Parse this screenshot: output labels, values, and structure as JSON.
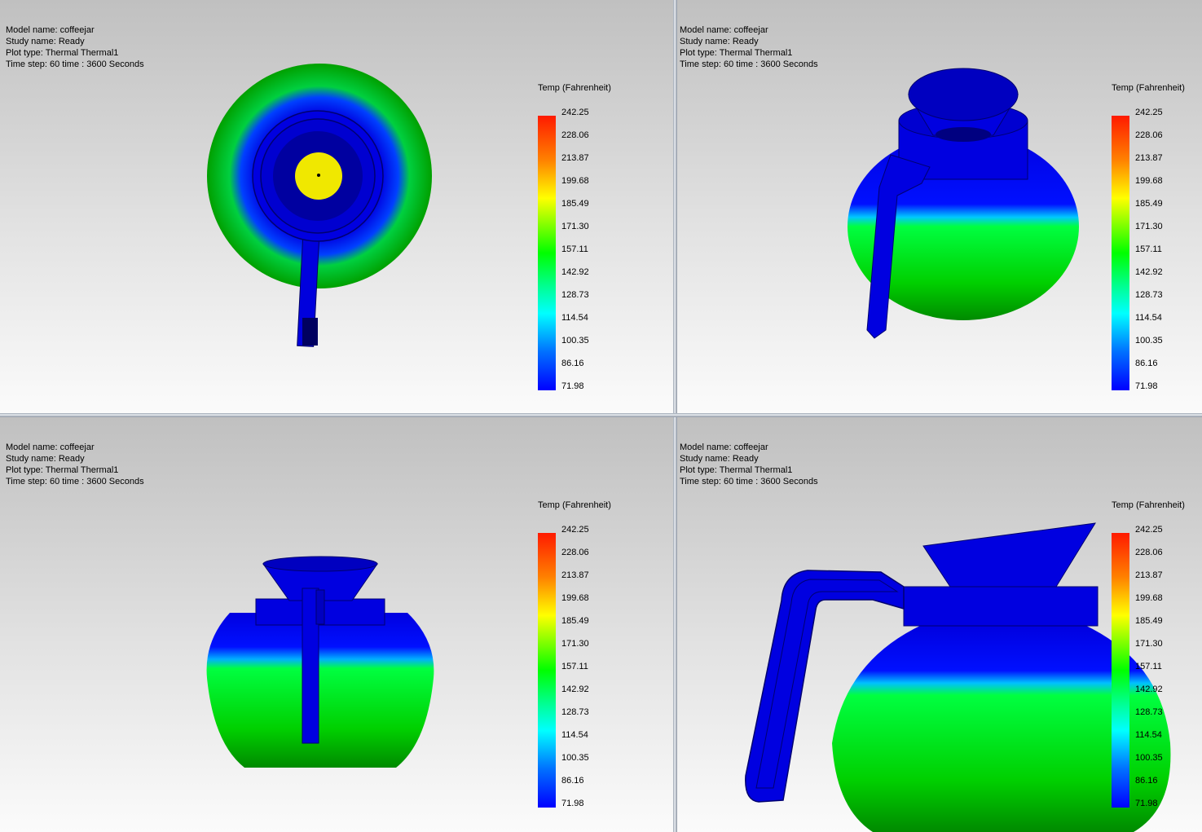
{
  "viewports": [
    {
      "info": {
        "model": "Model name: coffeejar",
        "study": "Study name: Ready",
        "plot": "Plot type: Thermal Thermal1",
        "time": "Time step: 60    time : 3600 Seconds"
      },
      "legend": {
        "title": "Temp (Fahrenheit)",
        "values": [
          "242.25",
          "228.06",
          "213.87",
          "199.68",
          "185.49",
          "171.30",
          "157.11",
          "142.92",
          "128.73",
          "114.54",
          "100.35",
          "86.16",
          "71.98"
        ]
      }
    },
    {
      "info": {
        "model": "Model name: coffeejar",
        "study": "Study name: Ready",
        "plot": "Plot type: Thermal Thermal1",
        "time": "Time step: 60    time : 3600 Seconds"
      },
      "legend": {
        "title": "Temp (Fahrenheit)",
        "values": [
          "242.25",
          "228.06",
          "213.87",
          "199.68",
          "185.49",
          "171.30",
          "157.11",
          "142.92",
          "128.73",
          "114.54",
          "100.35",
          "86.16",
          "71.98"
        ]
      }
    },
    {
      "info": {
        "model": "Model name: coffeejar",
        "study": "Study name: Ready",
        "plot": "Plot type: Thermal Thermal1",
        "time": "Time step: 60    time : 3600 Seconds"
      },
      "legend": {
        "title": "Temp (Fahrenheit)",
        "values": [
          "242.25",
          "228.06",
          "213.87",
          "199.68",
          "185.49",
          "171.30",
          "157.11",
          "142.92",
          "128.73",
          "114.54",
          "100.35",
          "86.16",
          "71.98"
        ]
      }
    },
    {
      "info": {
        "model": "Model name: coffeejar",
        "study": "Study name: Ready",
        "plot": "Plot type: Thermal Thermal1",
        "time": "Time step: 60    time : 3600 Seconds"
      },
      "legend": {
        "title": "Temp (Fahrenheit)",
        "values": [
          "242.25",
          "228.06",
          "213.87",
          "199.68",
          "185.49",
          "171.30",
          "157.11",
          "142.92",
          "128.73",
          "114.54",
          "100.35",
          "86.16",
          "71.98"
        ]
      }
    }
  ],
  "colors": {
    "cold": "#0000ff",
    "warm": "#00e000",
    "hot_spot": "#ffff00",
    "background_top": "#c0c0c0",
    "background_bottom": "#fbfbfb"
  }
}
